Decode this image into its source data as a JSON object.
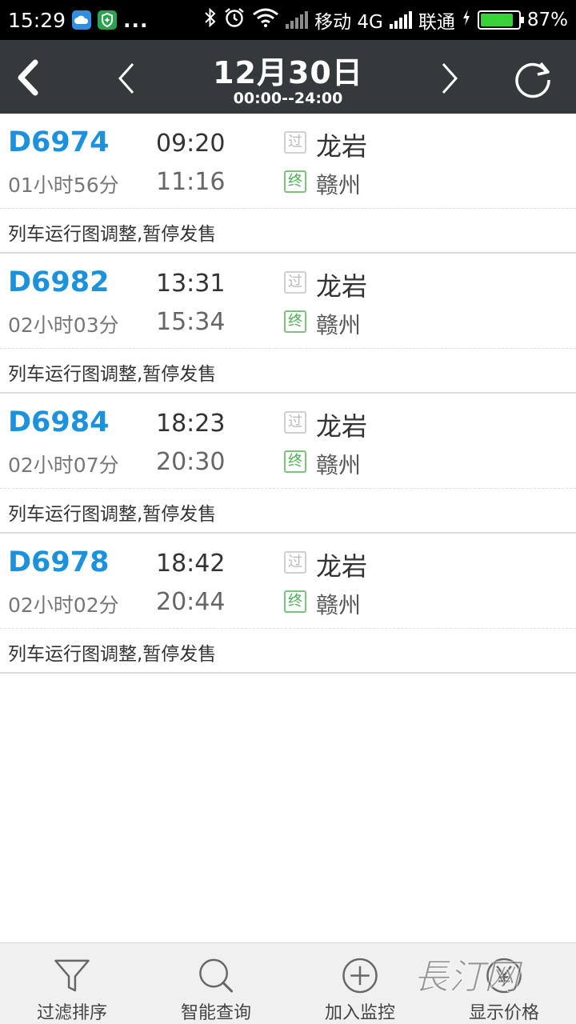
{
  "status_bar": {
    "time": "15:29",
    "more": "...",
    "carrier1": "移动 4G",
    "carrier2": "联通",
    "battery_percent": "87%",
    "battery_level": 0.87
  },
  "header": {
    "date": "12月30日",
    "time_range": "00:00--24:00"
  },
  "trains": [
    {
      "number": "D6974",
      "duration": "01小时56分",
      "depart": "09:20",
      "arrive": "11:16",
      "pass_badge": "过",
      "from": "龙岩",
      "end_badge": "终",
      "to": "赣州",
      "notice": "列车运行图调整,暂停发售"
    },
    {
      "number": "D6982",
      "duration": "02小时03分",
      "depart": "13:31",
      "arrive": "15:34",
      "pass_badge": "过",
      "from": "龙岩",
      "end_badge": "终",
      "to": "赣州",
      "notice": "列车运行图调整,暂停发售"
    },
    {
      "number": "D6984",
      "duration": "02小时07分",
      "depart": "18:23",
      "arrive": "20:30",
      "pass_badge": "过",
      "from": "龙岩",
      "end_badge": "终",
      "to": "赣州",
      "notice": "列车运行图调整,暂停发售"
    },
    {
      "number": "D6978",
      "duration": "02小时02分",
      "depart": "18:42",
      "arrive": "20:44",
      "pass_badge": "过",
      "from": "龙岩",
      "end_badge": "终",
      "to": "赣州",
      "notice": "列车运行图调整,暂停发售"
    }
  ],
  "toolbar": {
    "filter_label": "过滤排序",
    "smart_query_label": "智能查询",
    "add_monitor_label": "加入监控",
    "show_price_label": "显示价格"
  },
  "watermark_text": "長汀网",
  "colors": {
    "header_bg": "#343a3c",
    "train_number": "#1c92dc",
    "end_badge": "#4caf50"
  }
}
